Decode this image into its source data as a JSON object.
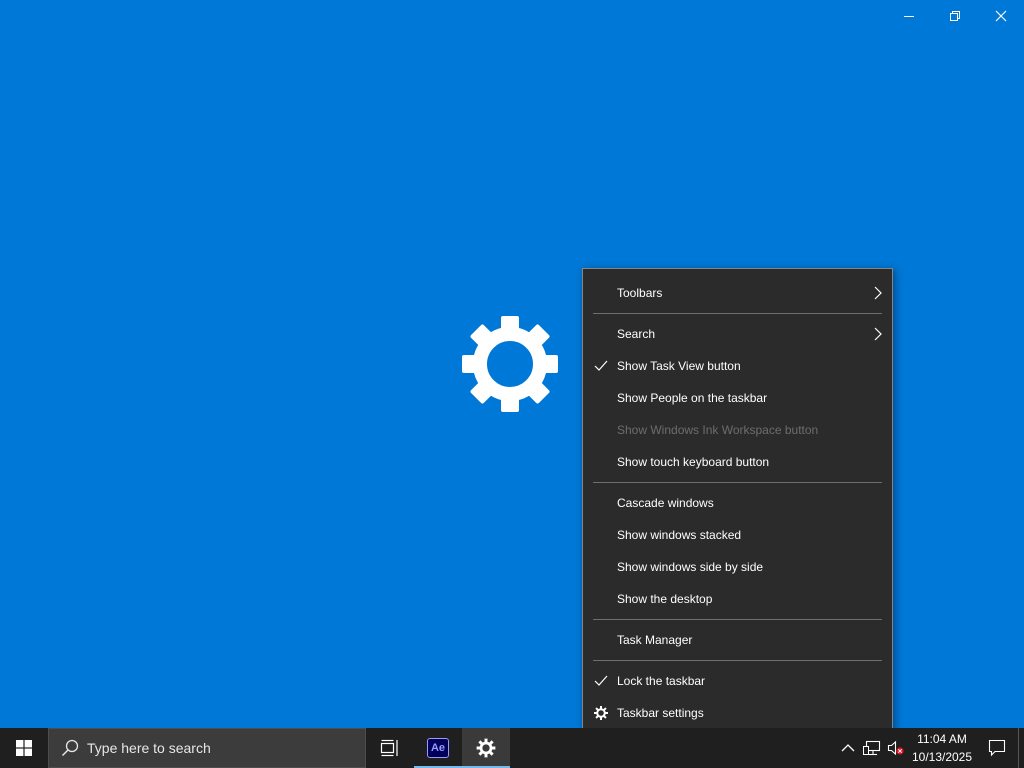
{
  "window_controls": {
    "minimize_icon": "minimize-icon",
    "restore_icon": "restore-icon",
    "close_icon": "close-icon"
  },
  "splash": {
    "icon": "gear-icon"
  },
  "context_menu": {
    "toolbars": "Toolbars",
    "search": "Search",
    "show_task_view": "Show Task View button",
    "show_people": "Show People on the taskbar",
    "show_ink_workspace": "Show Windows Ink Workspace button",
    "show_touch_keyboard": "Show touch keyboard button",
    "cascade": "Cascade windows",
    "stacked": "Show windows stacked",
    "side_by_side": "Show windows side by side",
    "show_desktop": "Show the desktop",
    "task_manager": "Task Manager",
    "lock_taskbar": "Lock the taskbar",
    "taskbar_settings": "Taskbar settings"
  },
  "taskbar": {
    "search_placeholder": "Type here to search",
    "apps": [
      {
        "name": "Task View",
        "icon": "task-view-icon"
      },
      {
        "name": "After Effects",
        "label": "Ae"
      },
      {
        "name": "Settings",
        "icon": "gear-icon"
      }
    ],
    "clock": {
      "time": "11:04 AM",
      "date": "10/13/2025"
    }
  },
  "colors": {
    "desktop": "#0078d7",
    "menu_bg": "#2b2b2b",
    "taskbar_bg": "#1f1f1f",
    "ae_bg": "#00005b",
    "ae_fg": "#9999ff"
  }
}
